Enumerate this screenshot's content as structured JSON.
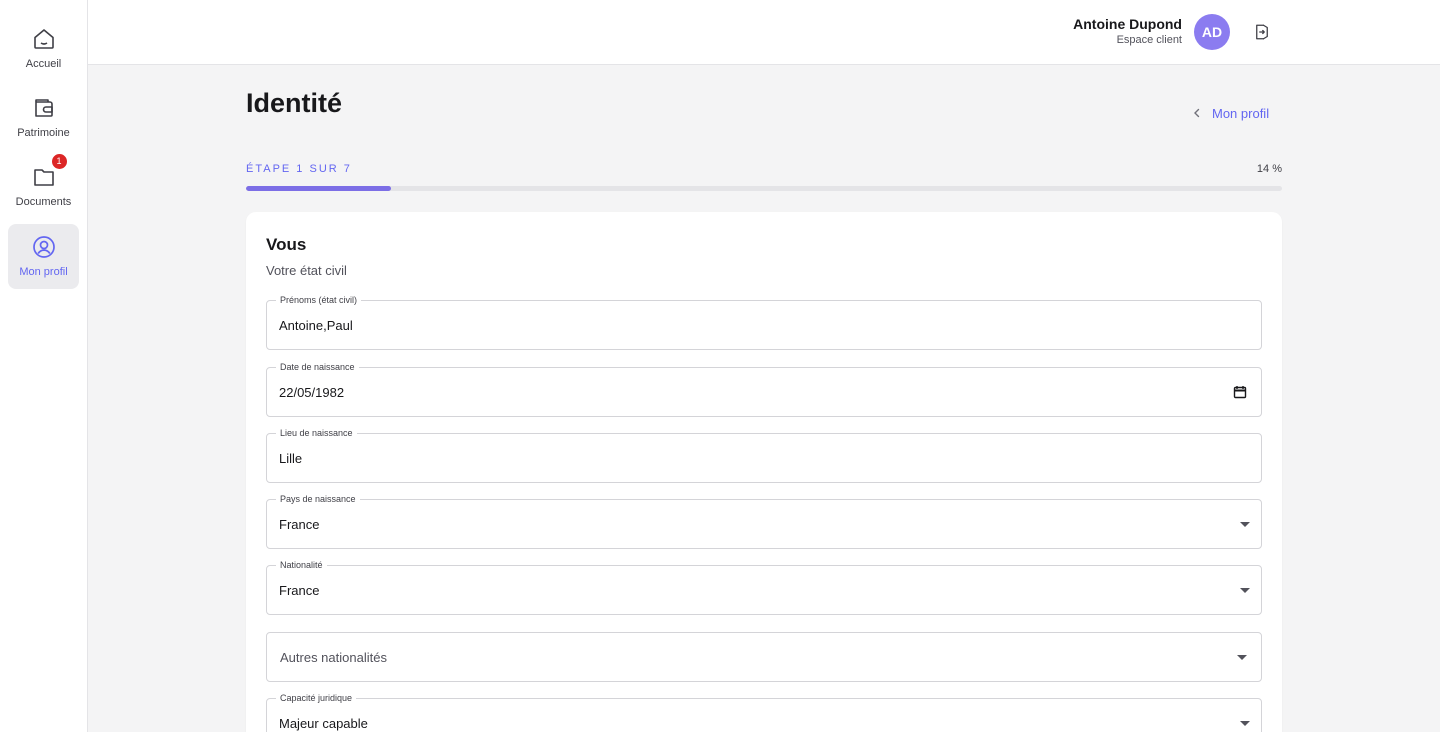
{
  "sidebar": {
    "items": [
      {
        "label": "Accueil",
        "icon": "home-icon"
      },
      {
        "label": "Patrimoine",
        "icon": "wallet-icon"
      },
      {
        "label": "Documents",
        "icon": "folder-icon",
        "badge": "1"
      },
      {
        "label": "Mon profil",
        "icon": "user-circle-icon",
        "active": true
      }
    ]
  },
  "header": {
    "user_name": "Antoine Dupond",
    "user_role": "Espace client",
    "avatar_initials": "AD"
  },
  "page": {
    "title": "Identité",
    "back_link": "Mon profil",
    "step_label": "ÉTAPE 1 SUR 7",
    "progress_percent_label": "14 %",
    "progress_fraction": 0.14
  },
  "card": {
    "title": "Vous",
    "subtitle": "Votre état civil",
    "fields": [
      {
        "label": "Prénoms (état civil)",
        "value": "Antoine,Paul"
      },
      {
        "label": "Date de naissance",
        "value": "22/05/1982"
      },
      {
        "label": "Lieu de naissance",
        "value": "Lille"
      },
      {
        "label": "Pays de naissance",
        "value": "France"
      },
      {
        "label": "Nationalité",
        "value": "France"
      },
      {
        "placeholder": "Autres nationalités"
      },
      {
        "label": "Capacité juridique",
        "value": "Majeur capable"
      }
    ]
  },
  "colors": {
    "accent": "#6366f1",
    "progress": "#7c6ee6",
    "avatar": "#8b7cf0",
    "badge": "#dc2626"
  }
}
